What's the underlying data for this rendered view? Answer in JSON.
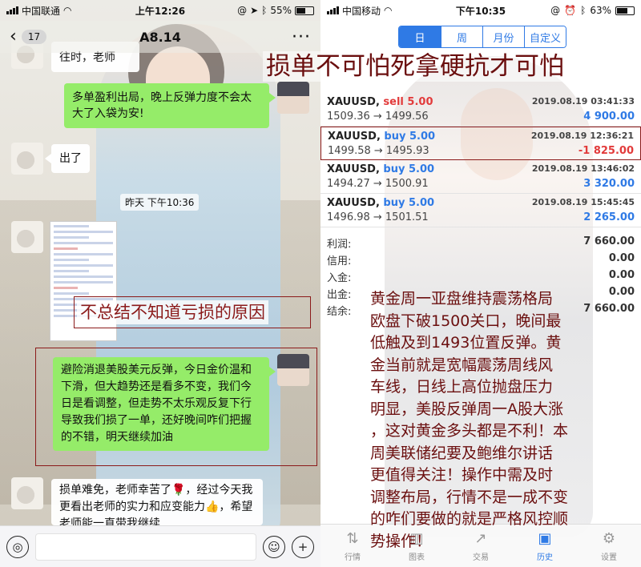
{
  "left": {
    "status_bar": {
      "carrier": "中国联通",
      "time": "上午12:26",
      "battery": "55%"
    },
    "nav": {
      "back": "‹",
      "badge": "17",
      "title": "A8.14",
      "more": "···"
    },
    "messages": [
      {
        "text": "往时，老师"
      },
      {
        "text": "多单盈利出局，晚上反弹力度不会太大了入袋为安!"
      },
      {
        "text": "出了"
      },
      {
        "text": "避险消退美股美元反弹，今日金价温和下滑，但大趋势还是看多不变，我们今日是看调整，但走势不太乐观反复下行导致我们损了一单，还好晚间咋们把握的不错，明天继续加油"
      },
      {
        "text": "损单难免，老师幸苦了🌹，经过今天我更看出老师的实力和应变能力👍，希望老师能一直带我继续"
      }
    ],
    "timestamp": "昨天 下午10:36",
    "caption": "不总结不知道亏损的原因",
    "input": {
      "voice_icon": "voice-icon",
      "emoji_icon": "emoji-icon",
      "plus_icon": "plus-icon"
    }
  },
  "right": {
    "status_bar": {
      "carrier": "中国移动",
      "time": "下午10:35",
      "battery": "63%"
    },
    "segments": [
      "日",
      "周",
      "月份",
      "自定义"
    ],
    "active_segment": 0,
    "headline": "损单不可怕死拿硬抗才可怕",
    "orders": [
      {
        "symbol": "XAUUSD,",
        "side": "sell 5.00",
        "side_type": "sell",
        "date": "2019.08.19 03:41:33",
        "prices": "1509.36 → 1499.56",
        "pnl": "4 900.00",
        "pnl_type": "pos"
      },
      {
        "symbol": "XAUUSD,",
        "side": "buy 5.00",
        "side_type": "buy",
        "date": "2019.08.19 12:36:21",
        "prices": "1499.58 → 1495.93",
        "pnl": "-1 825.00",
        "pnl_type": "neg"
      },
      {
        "symbol": "XAUUSD,",
        "side": "buy 5.00",
        "side_type": "buy",
        "date": "2019.08.19 13:46:02",
        "prices": "1494.27 → 1500.91",
        "pnl": "3 320.00",
        "pnl_type": "pos"
      },
      {
        "symbol": "XAUUSD,",
        "side": "buy 5.00",
        "side_type": "buy",
        "date": "2019.08.19 15:45:45",
        "prices": "1496.98 → 1501.51",
        "pnl": "2 265.00",
        "pnl_type": "pos"
      }
    ],
    "summary": [
      {
        "label": "利润:",
        "value": "7 660.00"
      },
      {
        "label": "信用:",
        "value": "0.00"
      },
      {
        "label": "入金:",
        "value": "0.00"
      },
      {
        "label": "出金:",
        "value": "0.00"
      },
      {
        "label": "结余:",
        "value": "7 660.00"
      }
    ],
    "commentary": "黄金周一亚盘维持震荡格局\n欧盘下破1500关口，晚间最\n低触及到1493位置反弹。黄\n金当前就是宽幅震荡周线风\n车线，日线上高位抛盘压力\n明显，美股反弹周一A股大涨\n，这对黄金多头都是不利！本\n周美联储纪要及鲍维尔讲话\n更值得关注！操作中需及时\n调整布局，行情不是一成不变\n的咋们要做的就是严格风控顺\n势操作！",
    "tabs": [
      {
        "label": "行情",
        "icon": "quotes-icon"
      },
      {
        "label": "图表",
        "icon": "chart-icon"
      },
      {
        "label": "交易",
        "icon": "trade-icon"
      },
      {
        "label": "历史",
        "icon": "history-icon"
      },
      {
        "label": "设置",
        "icon": "settings-icon"
      }
    ],
    "active_tab": 3
  },
  "colors": {
    "wechat_green": "#95ec69",
    "accent_blue": "#2f7ae5",
    "loss_red": "#e23b3b",
    "caption_red": "#8b1a1a"
  }
}
